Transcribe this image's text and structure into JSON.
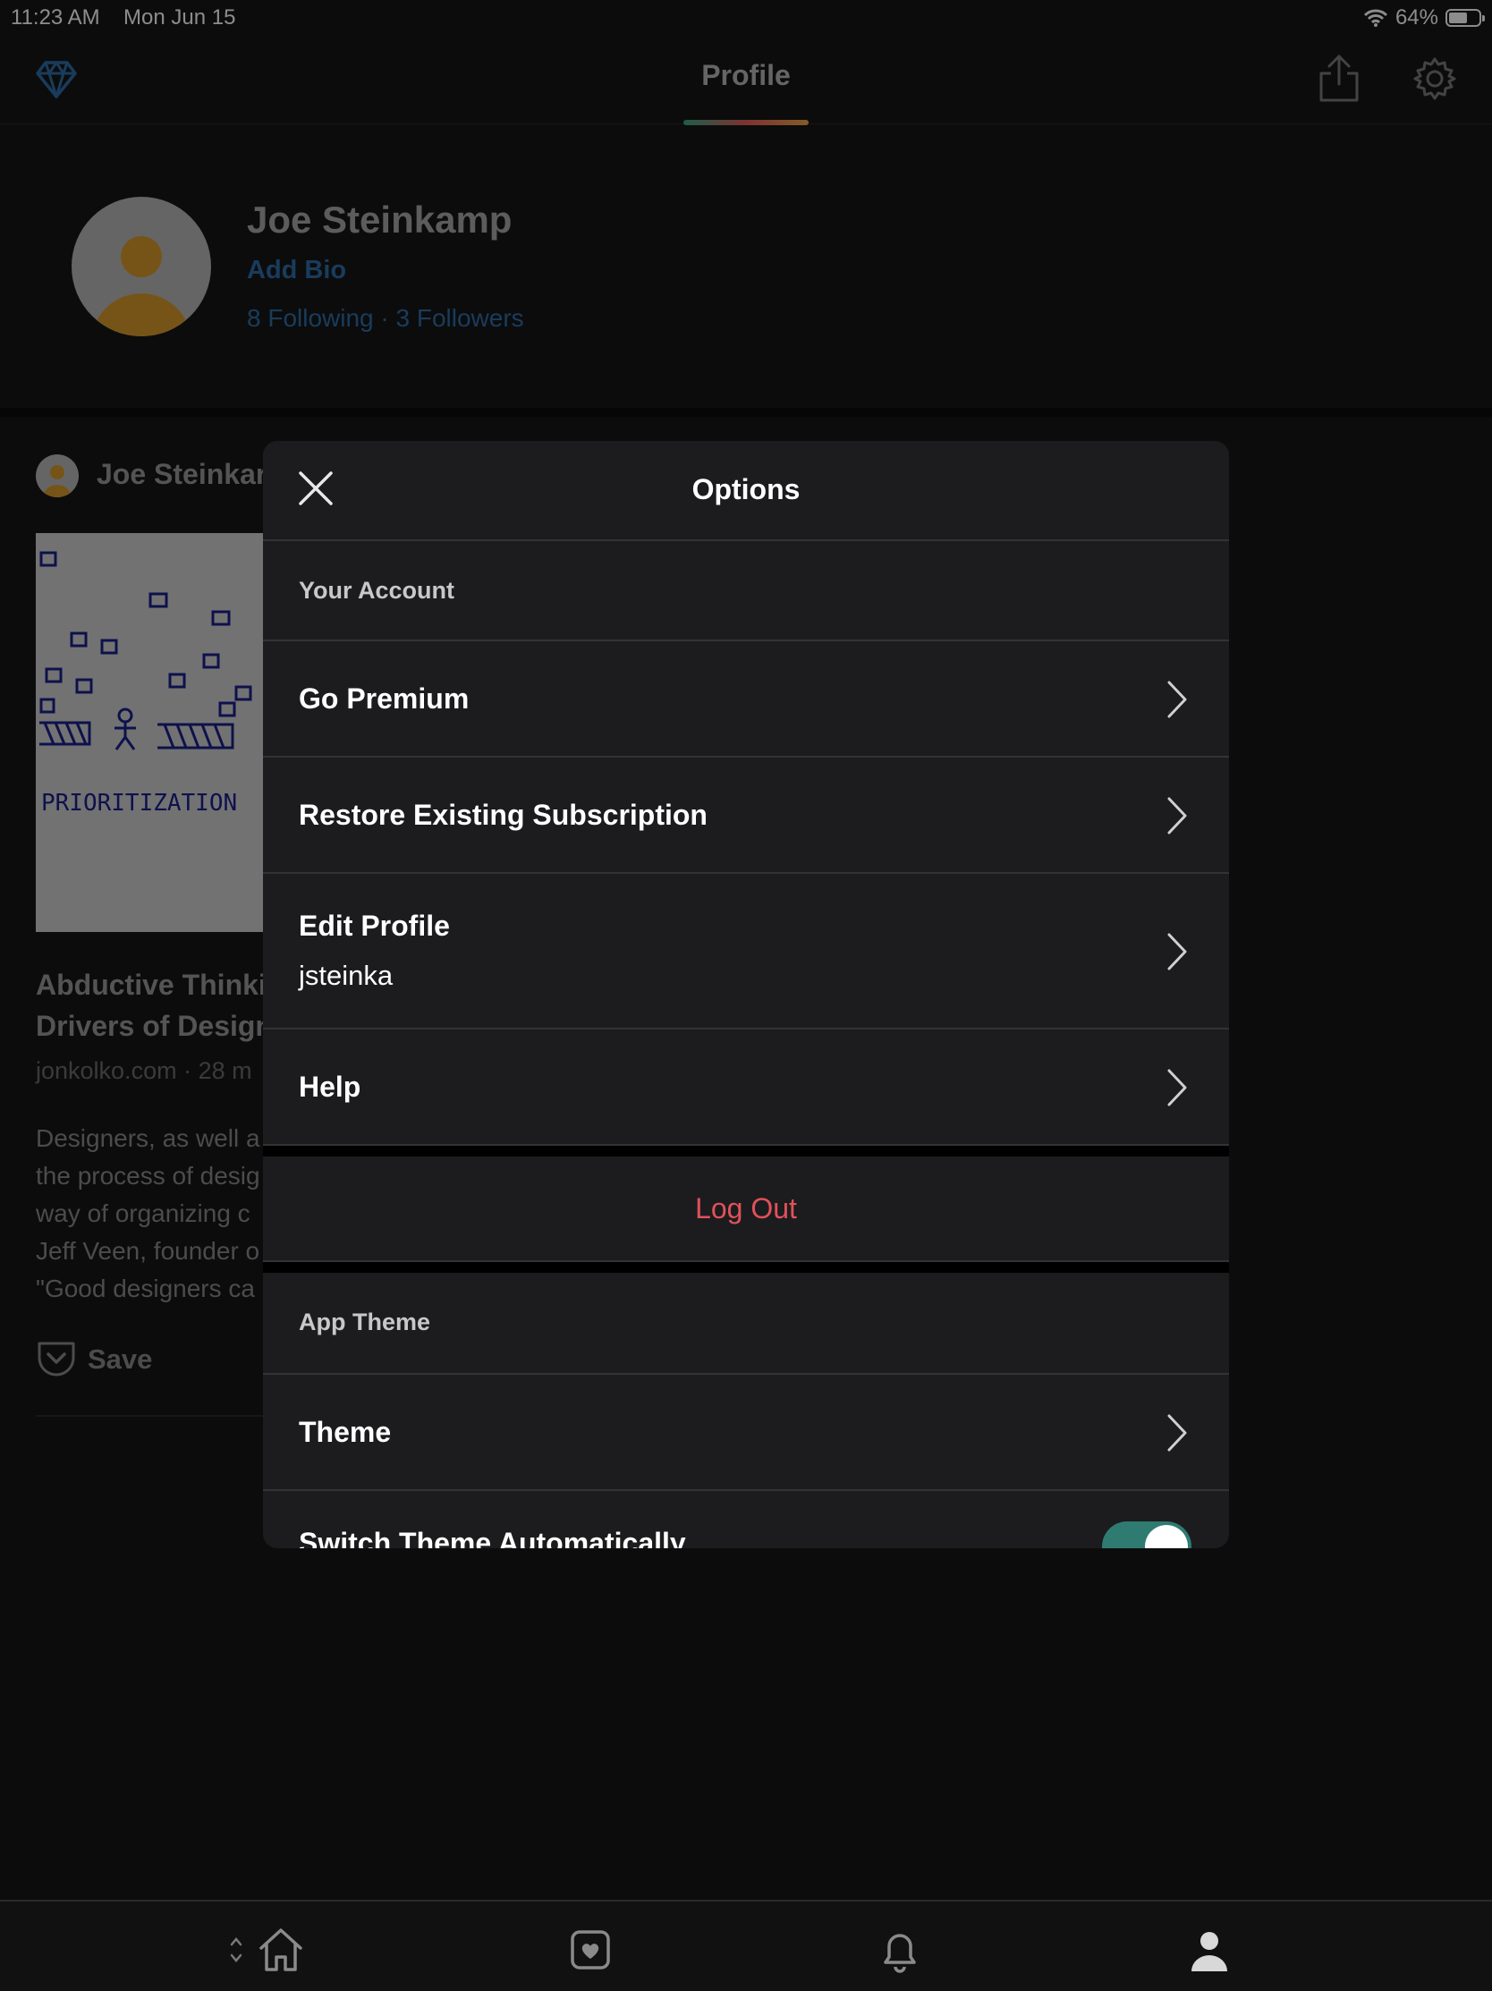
{
  "status_bar": {
    "time": "11:23 AM",
    "date": "Mon Jun 15",
    "battery": "64%",
    "battery_level": 0.64
  },
  "nav": {
    "title": "Profile",
    "icons": [
      "diamond-icon",
      "share-icon",
      "gear-icon"
    ]
  },
  "profile": {
    "name": "Joe Steinkamp",
    "bio_link": "Add Bio",
    "following_followers": "8 Following · 3 Followers"
  },
  "feed": {
    "author": "Joe Steinkar",
    "title_lines": [
      "Abductive Thinki",
      "Drivers of Design"
    ],
    "meta": "jonkolko.com · 28 m",
    "desc_lines": [
      "Designers, as well a",
      "the process of desig",
      "way of organizing c",
      "Jeff Veen, founder o",
      "\"Good designers ca"
    ],
    "save_label": "Save",
    "thumb_caption": "PRIORITIZATION"
  },
  "modal": {
    "title": "Options",
    "section_account": "Your Account",
    "go_premium": "Go Premium",
    "restore": "Restore Existing Subscription",
    "edit_profile": "Edit Profile",
    "username": "jsteinka",
    "help": "Help",
    "logout": "Log Out",
    "section_theme": "App Theme",
    "theme": "Theme",
    "switch_auto": "Switch Theme Automatically",
    "switch_auto_on": true
  },
  "colors": {
    "accent_blue": "#2f6ea8",
    "logout_red": "#e0525a",
    "toggle_green": "#2f7b72",
    "avatar_gold": "#d89a2c"
  },
  "tab_bar": {
    "icons": [
      "home-icon",
      "saves-icon",
      "bell-icon",
      "person-icon"
    ],
    "selected": "person-icon"
  }
}
